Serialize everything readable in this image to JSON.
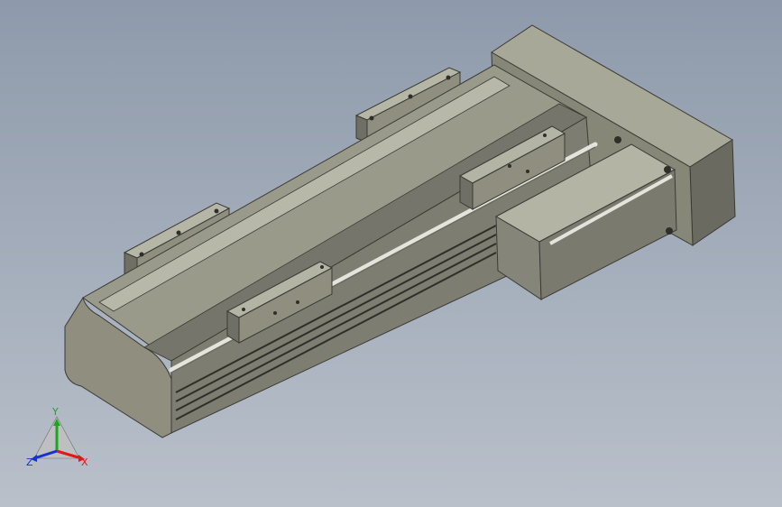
{
  "viewport": {
    "background_top": "#8e9aab",
    "background_bottom": "#b9c0ca"
  },
  "model": {
    "body_color": "#8f8e7f",
    "dark_color": "#5b5b52",
    "light_color": "#c6c6b8",
    "rail_color": "#e4e4dc"
  },
  "triad": {
    "x_label": "X",
    "y_label": "Y",
    "z_label": "Z",
    "x_color": "#e01818",
    "y_color": "#1aa81a",
    "z_color": "#1830d0"
  }
}
